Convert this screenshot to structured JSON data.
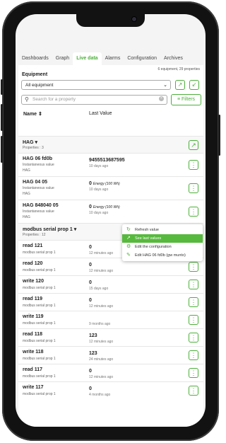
{
  "colors": {
    "accent": "#4caf3a",
    "frame": "#121212",
    "highlight": "#57b93d"
  },
  "tabs": [
    "Dashboards",
    "Graph",
    "Live data",
    "Alarms",
    "Configuration",
    "Archives"
  ],
  "active_tab": "Live data",
  "summary": "6 equipment, 29 properties",
  "equipment_label": "Equipment",
  "equipment_select": "All equipment",
  "search": {
    "placeholder": "Search for a property"
  },
  "filters_label": "Filters",
  "table": {
    "col_name": "Name",
    "col_value": "Last Value"
  },
  "groups": [
    {
      "name": "HAG",
      "props_count": "Properties : 3",
      "rows": [
        {
          "name": "HAG 06 fd0b",
          "type": "Instantaneous value",
          "sub": "HAG",
          "value": "9455513687595",
          "unit": "",
          "time": "10 days ago"
        },
        {
          "name": "HAG 04 05",
          "type": "Instantaneous value",
          "sub": "HAG",
          "value": "0",
          "unit": "Energy (100 Wh)",
          "time": "10 days ago"
        },
        {
          "name": "HAG 848040 05",
          "type": "Instantaneous value",
          "sub": "HAG",
          "value": "0",
          "unit": "Energy (100 Wh)",
          "time": "10 days ago"
        }
      ]
    },
    {
      "name": "modbus serial prop 1",
      "props_count": "Properties : 12",
      "rows": [
        {
          "name": "read 121",
          "sub": "modbus serial prop 1",
          "value": "0",
          "time": "12 minutes ago"
        },
        {
          "name": "read 120",
          "sub": "modbus serial prop 1",
          "value": "0",
          "time": "12 minutes ago"
        },
        {
          "name": "write 120",
          "sub": "modbus serial prop 1",
          "value": "0",
          "time": "15 days ago"
        },
        {
          "name": "read 119",
          "sub": "modbus serial prop 1",
          "value": "0",
          "time": "12 minutes ago"
        },
        {
          "name": "write 119",
          "sub": "modbus serial prop 1",
          "value": "",
          "time": "9 months ago"
        },
        {
          "name": "read 118",
          "sub": "modbus serial prop 1",
          "value": "123",
          "time": "12 minutes ago"
        },
        {
          "name": "write 118",
          "sub": "modbus serial prop 1",
          "value": "123",
          "time": "24 minutes ago"
        },
        {
          "name": "read 117",
          "sub": "modbus serial prop 1",
          "value": "0",
          "time": "12 minutes ago"
        },
        {
          "name": "write 117",
          "sub": "modbus serial prop 1",
          "value": "0",
          "time": "4 months ago"
        }
      ]
    }
  ],
  "context_menu": [
    {
      "label": "Refresh value",
      "icon": "refresh-icon",
      "highlighted": false
    },
    {
      "label": "See last values",
      "icon": "line-chart-icon",
      "highlighted": true
    },
    {
      "label": "Edit the configuration",
      "icon": "settings-icon",
      "highlighted": false
    },
    {
      "label": "Edit HAG 06 fd0b (gw munto)",
      "icon": "edit-icon",
      "highlighted": false
    }
  ]
}
